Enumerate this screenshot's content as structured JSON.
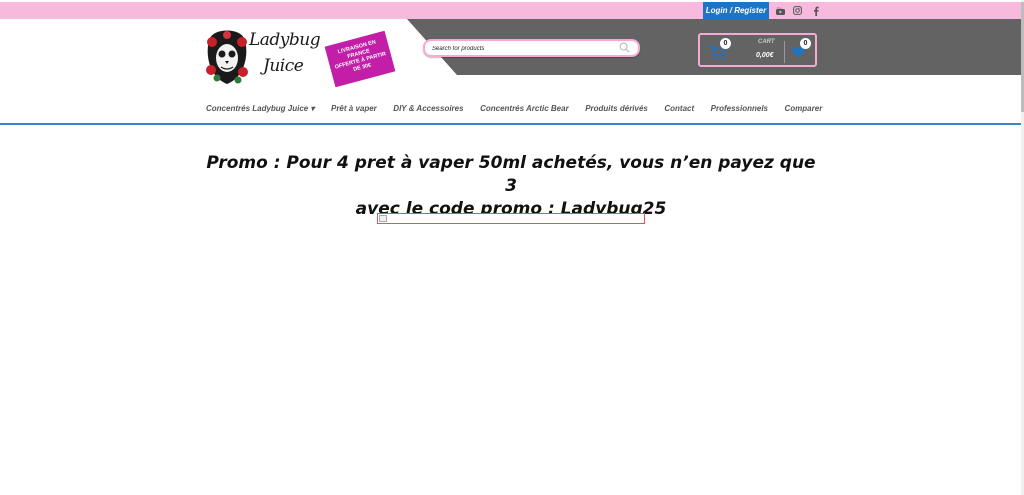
{
  "topbar": {
    "login_label": "Login / Register",
    "social": [
      "youtube-icon",
      "instagram-icon",
      "facebook-icon"
    ]
  },
  "logo": {
    "line1": "Ladybug",
    "line2": "Juice"
  },
  "promo_badge": {
    "line1": "LIVRAISON EN FRANCE",
    "line2": "OFFERTE À PARTIR",
    "line3": "DE 30€"
  },
  "search": {
    "placeholder": "Search for products"
  },
  "cart": {
    "count": "0",
    "label": "CART",
    "total": "0,00€",
    "wishlist_count": "0"
  },
  "nav": {
    "items": [
      "Concentrés Ladybug Juice ▾",
      "Prêt à vaper",
      "DIY & Accessoires",
      "Concentrés Arctic Bear",
      "Produits dérivés",
      "Contact",
      "Professionnels",
      "Comparer"
    ]
  },
  "main": {
    "headline_line1": "Promo : Pour 4 pret à vaper 50ml achetés, vous n’en payez que 3",
    "headline_line2": "avec le code promo : Ladybug25"
  },
  "colors": {
    "topbar": "#f7b9dc",
    "accent_blue": "#1f74c1",
    "header_dark": "#636363",
    "pink_border": "#f7a9d4",
    "badge": "#c21ea7"
  }
}
